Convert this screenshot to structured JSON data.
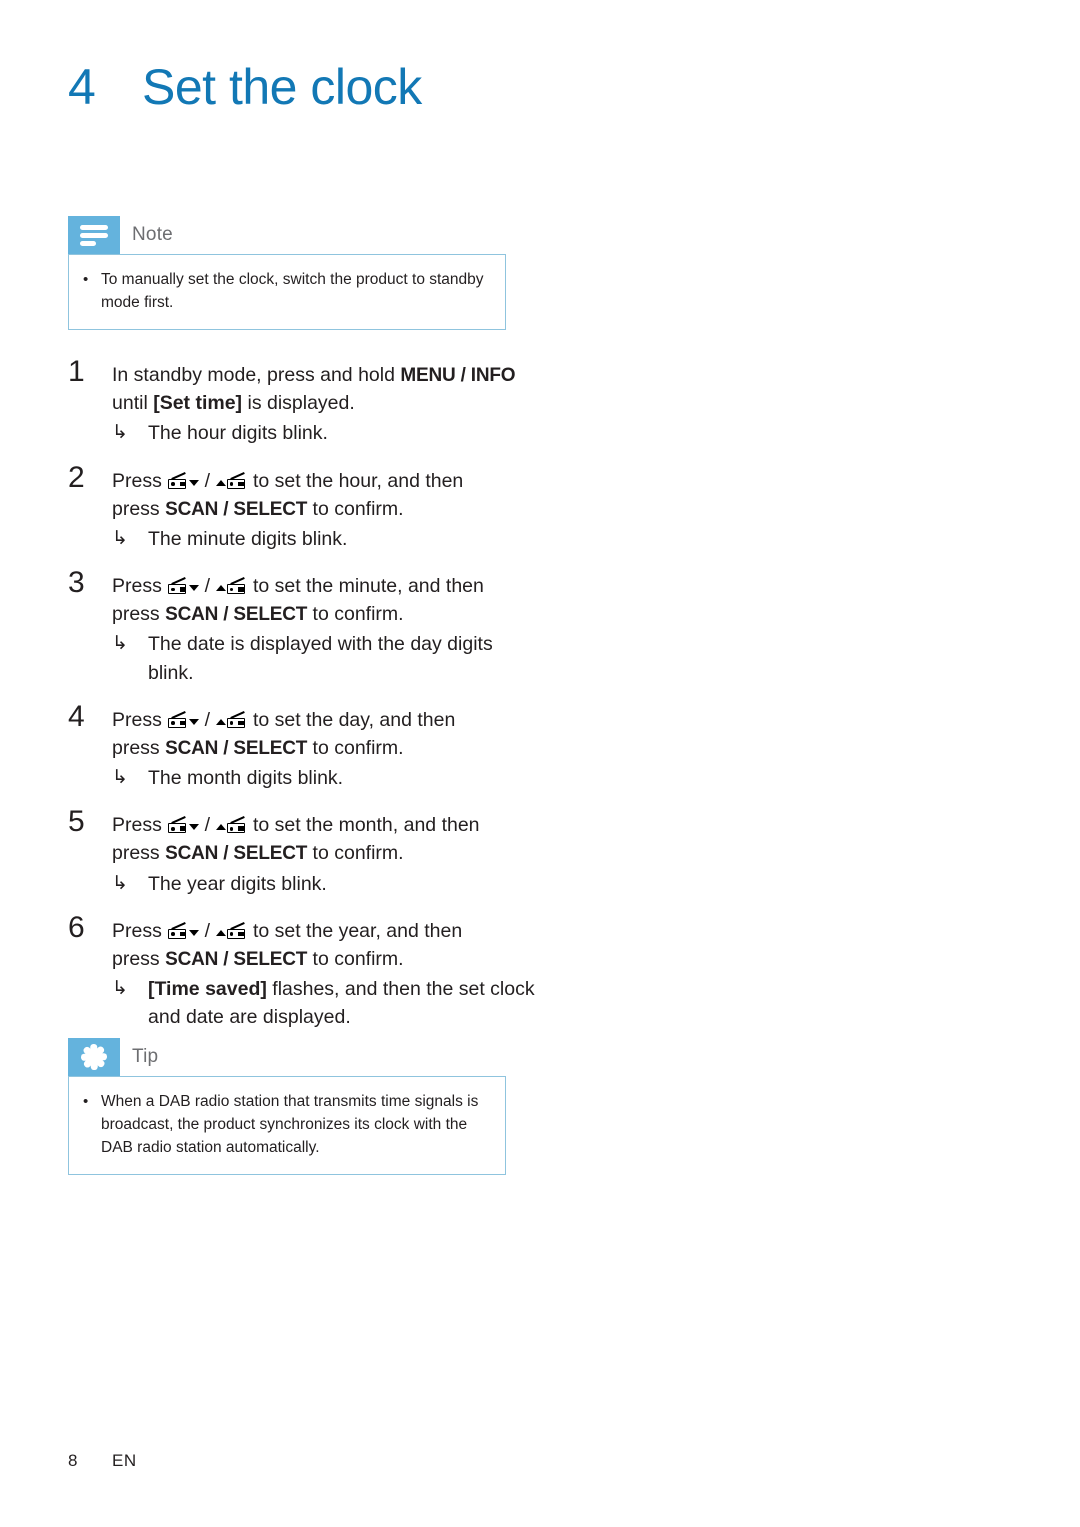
{
  "colors": {
    "heading_blue": "#1278b5",
    "callout_header_blue": "#64b3dd",
    "callout_border_blue": "#8fc4de",
    "callout_label_gray": "#6d6e71",
    "body_text": "#231f20"
  },
  "chapter": {
    "number": "4",
    "title": "Set the clock"
  },
  "note": {
    "label": "Note",
    "icon": "note-lines-icon",
    "bullet": "•",
    "items": [
      "To manually set the clock, switch the product to standby mode first."
    ]
  },
  "tip": {
    "label": "Tip",
    "icon": "starburst-icon",
    "bullet": "•",
    "items": [
      "When a DAB radio station that transmits time signals is broadcast, the product synchronizes its clock with the DAB radio station automatically."
    ]
  },
  "arrow_glyph": "↳",
  "steps": [
    {
      "number": "1",
      "lines": [
        {
          "segments": [
            {
              "type": "text",
              "text": "In standby mode, press and hold "
            },
            {
              "type": "kbd",
              "text": "MENU / INFO"
            }
          ]
        },
        {
          "segments": [
            {
              "type": "text",
              "text": "until "
            },
            {
              "type": "bold",
              "text": "[Set time]"
            },
            {
              "type": "text",
              "text": " is displayed."
            }
          ]
        }
      ],
      "results": [
        "The hour digits blink."
      ]
    },
    {
      "number": "2",
      "lines": [
        {
          "segments": [
            {
              "type": "text",
              "text": "Press "
            },
            {
              "type": "icon",
              "text": "preset-down-icon"
            },
            {
              "type": "text",
              "text": " / "
            },
            {
              "type": "icon",
              "text": "preset-up-icon"
            },
            {
              "type": "text",
              "text": " to set the hour, and then"
            }
          ]
        },
        {
          "segments": [
            {
              "type": "text",
              "text": "press "
            },
            {
              "type": "kbd",
              "text": "SCAN / SELECT"
            },
            {
              "type": "text",
              "text": " to confirm."
            }
          ]
        }
      ],
      "results": [
        "The minute digits blink."
      ]
    },
    {
      "number": "3",
      "lines": [
        {
          "segments": [
            {
              "type": "text",
              "text": "Press "
            },
            {
              "type": "icon",
              "text": "preset-down-icon"
            },
            {
              "type": "text",
              "text": " / "
            },
            {
              "type": "icon",
              "text": "preset-up-icon"
            },
            {
              "type": "text",
              "text": " to set the minute, and then"
            }
          ]
        },
        {
          "segments": [
            {
              "type": "text",
              "text": "press "
            },
            {
              "type": "kbd",
              "text": "SCAN / SELECT"
            },
            {
              "type": "text",
              "text": " to confirm."
            }
          ]
        }
      ],
      "results": [
        "The date is displayed with the day digits blink."
      ]
    },
    {
      "number": "4",
      "lines": [
        {
          "segments": [
            {
              "type": "text",
              "text": "Press "
            },
            {
              "type": "icon",
              "text": "preset-down-icon"
            },
            {
              "type": "text",
              "text": " / "
            },
            {
              "type": "icon",
              "text": "preset-up-icon"
            },
            {
              "type": "text",
              "text": " to set the day, and then"
            }
          ]
        },
        {
          "segments": [
            {
              "type": "text",
              "text": "press "
            },
            {
              "type": "kbd",
              "text": "SCAN / SELECT"
            },
            {
              "type": "text",
              "text": " to confirm."
            }
          ]
        }
      ],
      "results": [
        "The month digits blink."
      ]
    },
    {
      "number": "5",
      "lines": [
        {
          "segments": [
            {
              "type": "text",
              "text": "Press "
            },
            {
              "type": "icon",
              "text": "preset-down-icon"
            },
            {
              "type": "text",
              "text": " / "
            },
            {
              "type": "icon",
              "text": "preset-up-icon"
            },
            {
              "type": "text",
              "text": " to set the month, and then"
            }
          ]
        },
        {
          "segments": [
            {
              "type": "text",
              "text": "press "
            },
            {
              "type": "kbd",
              "text": "SCAN / SELECT"
            },
            {
              "type": "text",
              "text": " to confirm."
            }
          ]
        }
      ],
      "results": [
        "The year digits blink."
      ]
    },
    {
      "number": "6",
      "lines": [
        {
          "segments": [
            {
              "type": "text",
              "text": "Press "
            },
            {
              "type": "icon",
              "text": "preset-down-icon"
            },
            {
              "type": "text",
              "text": " / "
            },
            {
              "type": "icon",
              "text": "preset-up-icon"
            },
            {
              "type": "text",
              "text": " to set the year, and then"
            }
          ]
        },
        {
          "segments": [
            {
              "type": "text",
              "text": "press "
            },
            {
              "type": "kbd",
              "text": "SCAN / SELECT"
            },
            {
              "type": "text",
              "text": " to confirm."
            }
          ]
        }
      ],
      "results_rich": [
        [
          {
            "type": "bold",
            "text": "[Time saved]"
          },
          {
            "type": "text",
            "text": " flashes, and then the set clock and date are displayed."
          }
        ]
      ]
    }
  ],
  "footer": {
    "page": "8",
    "language": "EN"
  }
}
